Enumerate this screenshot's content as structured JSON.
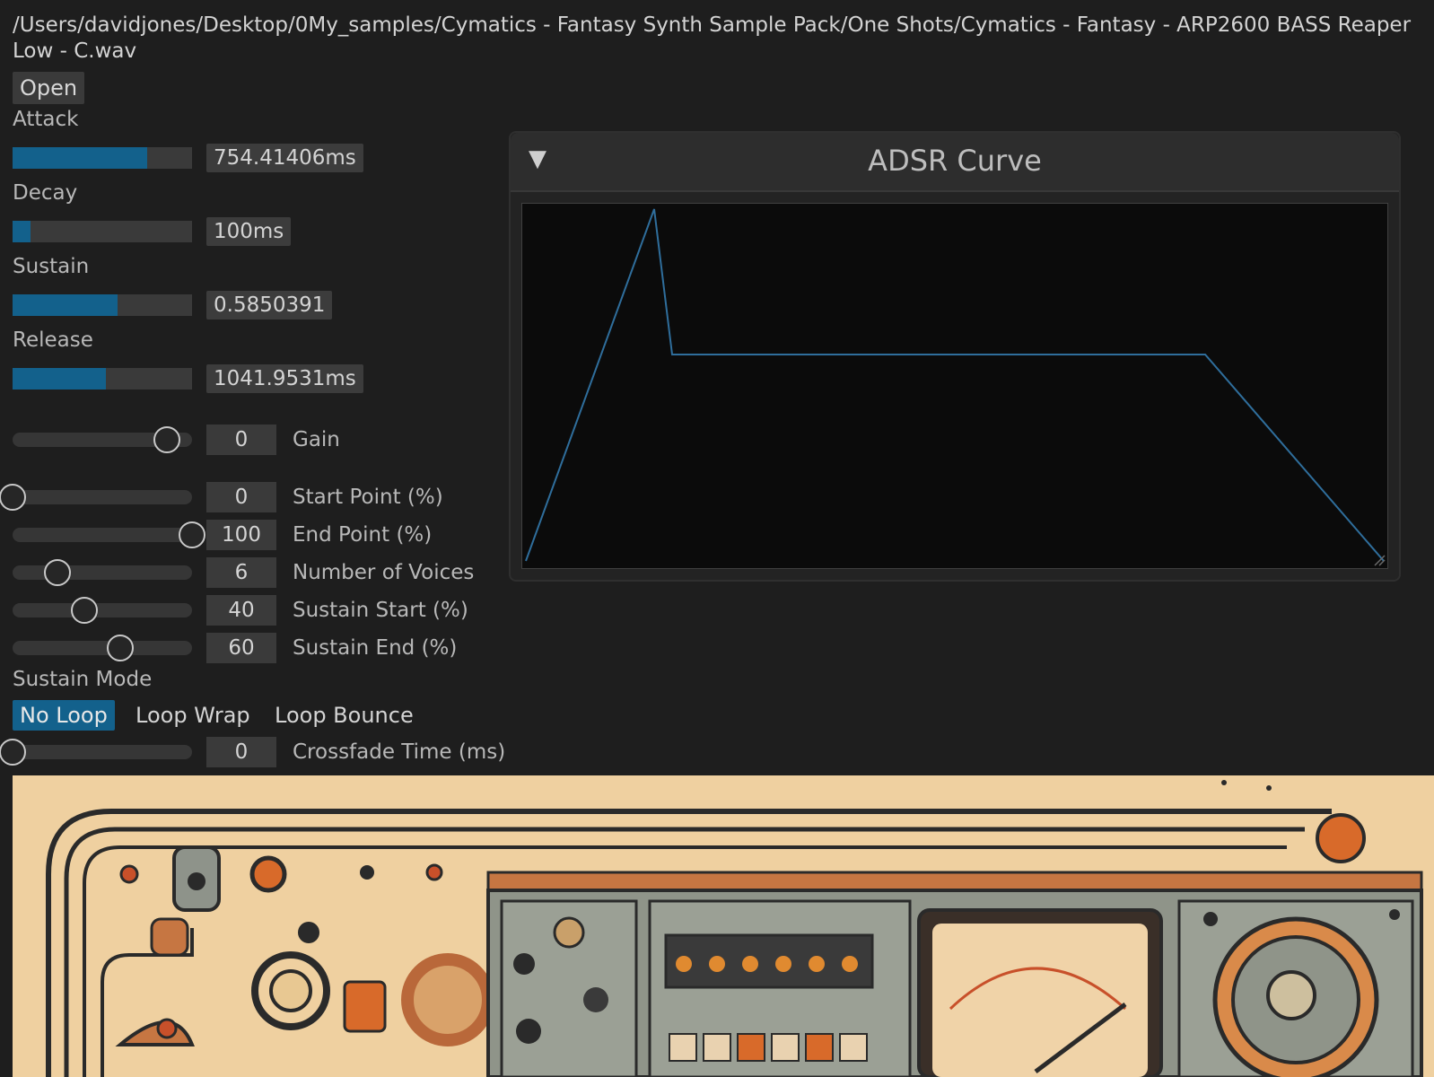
{
  "file_path": "/Users/davidjones/Desktop/0My_samples/Cymatics - Fantasy Synth Sample Pack/One Shots/Cymatics - Fantasy - ARP2600 BASS Reaper Low - C.wav",
  "open_button": "Open",
  "envelope": {
    "attack": {
      "label": "Attack",
      "value": "754.41406ms",
      "fraction": 0.75
    },
    "decay": {
      "label": "Decay",
      "value": "100ms",
      "fraction": 0.1
    },
    "sustain": {
      "label": "Sustain",
      "value": "0.5850391",
      "fraction": 0.585
    },
    "release": {
      "label": "Release",
      "value": "1041.9531ms",
      "fraction": 0.52
    }
  },
  "sliders": [
    {
      "label": "Gain",
      "value": "0",
      "fraction": 0.86
    },
    {
      "label": "Start Point (%)",
      "value": "0",
      "fraction": 0.0
    },
    {
      "label": "End Point (%)",
      "value": "100",
      "fraction": 1.0
    },
    {
      "label": "Number of Voices",
      "value": "6",
      "fraction": 0.25
    },
    {
      "label": "Sustain Start (%)",
      "value": "40",
      "fraction": 0.4
    },
    {
      "label": "Sustain End (%)",
      "value": "60",
      "fraction": 0.6
    }
  ],
  "sustain_mode": {
    "label": "Sustain Mode",
    "options": [
      "No Loop",
      "Loop Wrap",
      "Loop Bounce"
    ],
    "selected": "No Loop"
  },
  "crossfade": {
    "label": "Crossfade Time (ms)",
    "value": "0",
    "fraction": 0.0
  },
  "adsr_panel": {
    "title": "ADSR Curve",
    "collapse_glyph": "▼",
    "line_color": "#2f6e9c"
  },
  "colors": {
    "accent": "#13618c",
    "background": "#1e1e1e"
  }
}
